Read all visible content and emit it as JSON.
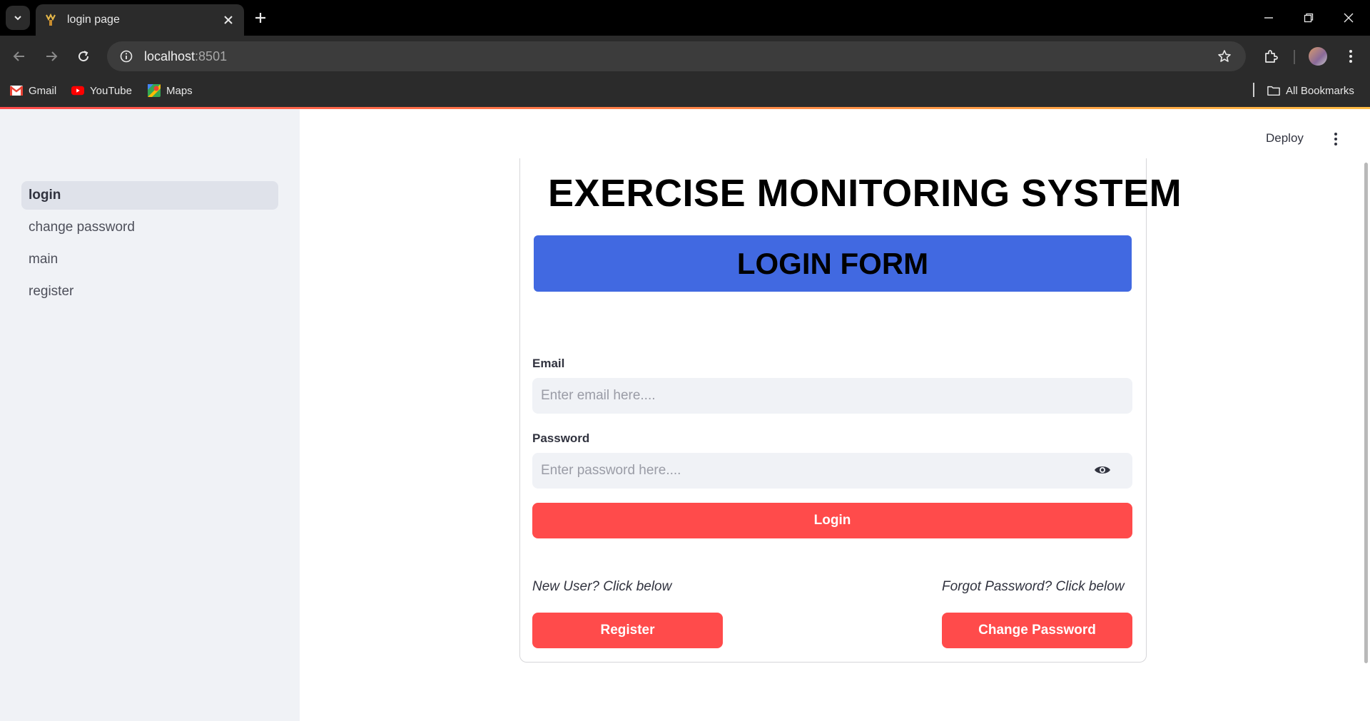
{
  "browser": {
    "tab_title": "login page",
    "url_host": "localhost",
    "url_port": ":8501",
    "bookmarks": [
      {
        "label": "Gmail",
        "icon": "gmail-icon"
      },
      {
        "label": "YouTube",
        "icon": "youtube-icon"
      },
      {
        "label": "Maps",
        "icon": "maps-icon"
      }
    ],
    "all_bookmarks_label": "All Bookmarks"
  },
  "header": {
    "deploy_label": "Deploy"
  },
  "sidebar": {
    "items": [
      {
        "label": "login",
        "active": true
      },
      {
        "label": "change password",
        "active": false
      },
      {
        "label": "main",
        "active": false
      },
      {
        "label": "register",
        "active": false
      }
    ]
  },
  "main": {
    "title": "EXERCISE MONITORING SYSTEM",
    "banner": "LOGIN FORM",
    "email_label": "Email",
    "email_placeholder": "Enter email here....",
    "password_label": "Password",
    "password_placeholder": "Enter password here....",
    "login_label": "Login",
    "new_user_hint": "New User? Click below",
    "register_label": "Register",
    "forgot_hint": "Forgot Password? Click below",
    "change_password_label": "Change Password"
  },
  "colors": {
    "accent": "#ff4b4b",
    "banner": "#4169e1",
    "sidebar_bg": "#f0f2f6"
  }
}
